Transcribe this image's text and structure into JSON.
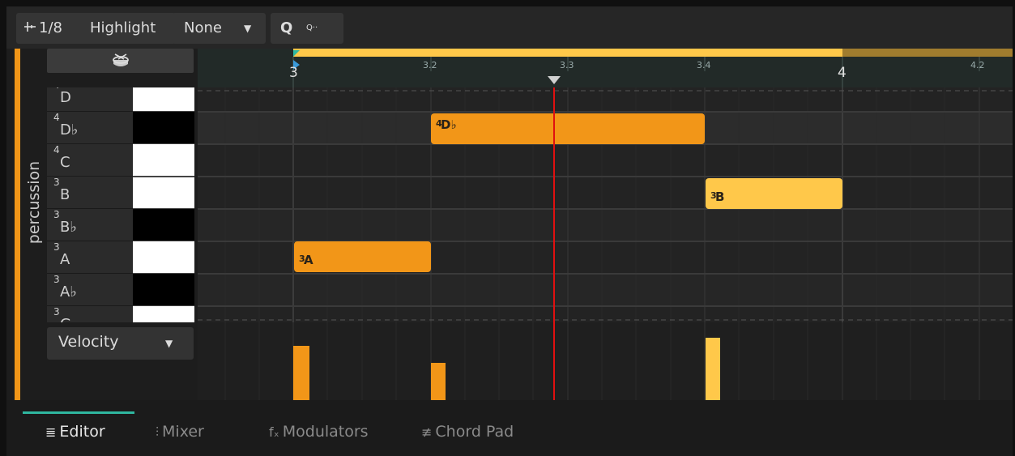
{
  "toolbar": {
    "snap_icon": "snap-grid-icon",
    "snap_value": "1/8",
    "highlight_label": "Highlight",
    "highlight_value": "None",
    "quantize_label": "Q",
    "quantize_options_label": "Q··"
  },
  "track": {
    "name": "percussion",
    "accent_color": "#f29618",
    "drum_icon": "drum-icon"
  },
  "ruler": {
    "bar_labels": [
      "3",
      "4"
    ],
    "beat_labels": [
      "3.2",
      "3.3",
      "3.4",
      "4.2"
    ],
    "playhead_marker": "playhead-triangle-icon",
    "loop_color": "#ffc84a"
  },
  "keys": [
    {
      "name": "D",
      "octave": "4",
      "color": "white"
    },
    {
      "name": "D♭",
      "octave": "4",
      "color": "black"
    },
    {
      "name": "C",
      "octave": "4",
      "color": "white"
    },
    {
      "name": "B",
      "octave": "3",
      "color": "white"
    },
    {
      "name": "B♭",
      "octave": "3",
      "color": "black"
    },
    {
      "name": "A",
      "octave": "3",
      "color": "white"
    },
    {
      "name": "A♭",
      "octave": "3",
      "color": "black"
    },
    {
      "name": "G",
      "octave": "3",
      "color": "white"
    }
  ],
  "notes": [
    {
      "pitch": "D♭",
      "octave": "4",
      "start": "3.2",
      "end": "3.4",
      "color": "#f29618"
    },
    {
      "pitch": "B",
      "octave": "3",
      "start": "3.4",
      "end": "4",
      "color": "#ffc84a"
    },
    {
      "pitch": "A",
      "octave": "3",
      "start": "3",
      "end": "3.2",
      "color": "#f29618"
    }
  ],
  "playhead": {
    "position": "3.3",
    "color": "#e01010"
  },
  "velocity": {
    "selector_label": "Velocity",
    "bars": [
      {
        "note": "A3",
        "level": 0.7,
        "color": "#f29618"
      },
      {
        "note": "D♭4",
        "level": 0.48,
        "color": "#f29618"
      },
      {
        "note": "B3",
        "level": 0.8,
        "color": "#ffc84a"
      }
    ]
  },
  "tabs": [
    {
      "label": "Editor",
      "icon": "editor-icon",
      "glyph": "≣",
      "active": true
    },
    {
      "label": "Mixer",
      "icon": "mixer-icon",
      "glyph": "⫶",
      "active": false
    },
    {
      "label": "Modulators",
      "icon": "modulators-icon",
      "glyph": "fₓ",
      "active": false
    },
    {
      "label": "Chord Pad",
      "icon": "chord-pad-icon",
      "glyph": "≢",
      "active": false
    }
  ],
  "active_tab_color": "#2fb7a0"
}
